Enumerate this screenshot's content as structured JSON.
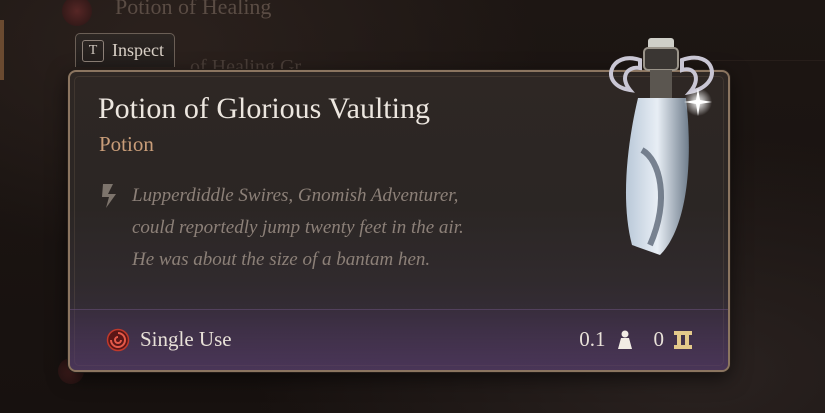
{
  "background": {
    "list_item_top": "Potion of Healing",
    "list_item_partial": "of Healing Gr"
  },
  "inspect": {
    "key": "T",
    "label": "Inspect"
  },
  "item": {
    "title": "Potion of Glorious Vaulting",
    "type": "Potion",
    "flavor_lines": [
      "Lupperdiddle Swires, Gnomish Adventurer,",
      "could reportedly jump twenty feet in the air.",
      "He was about the size of a bantam hen."
    ],
    "usage": "Single Use",
    "weight": "0.1",
    "value": "0"
  },
  "colors": {
    "title": "#ece6df",
    "type": "#c99d79",
    "flavor": "#8c8078",
    "border": "#8b7560",
    "single_use_icon": "#c0392b"
  },
  "icons": {
    "key": "keyboard-key-icon",
    "quote": "quote-mark-icon",
    "usage": "single-use-icon",
    "weight": "weight-icon",
    "value": "gold-coin-icon",
    "item_art": "potion-bottle-icon"
  }
}
